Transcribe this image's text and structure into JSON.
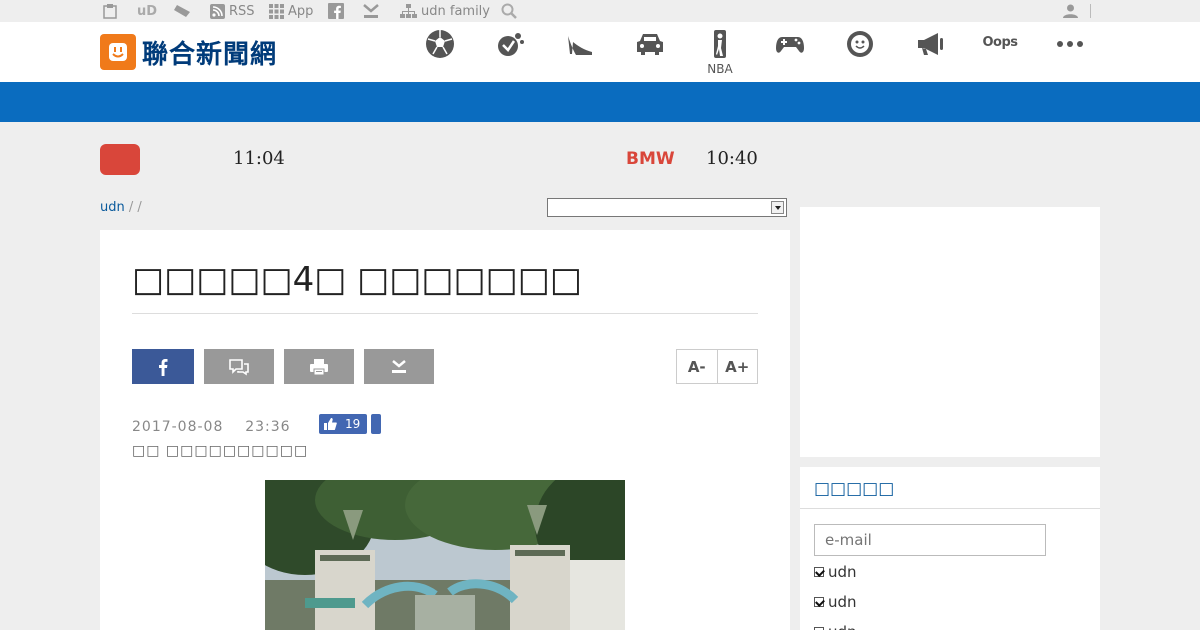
{
  "topbar": {
    "ud_label": "uD",
    "rss_label": "RSS",
    "app_label": "App",
    "family_label": "udn family"
  },
  "header": {
    "logo_text": "聯合新聞網",
    "nav": [
      {
        "icon": "soccer-ball-icon",
        "label": ""
      },
      {
        "icon": "paint-splash-icon",
        "label": ""
      },
      {
        "icon": "high-heel-icon",
        "label": ""
      },
      {
        "icon": "car-icon",
        "label": ""
      },
      {
        "icon": "nba-logo-icon",
        "label": "NBA"
      },
      {
        "icon": "gamepad-icon",
        "label": ""
      },
      {
        "icon": "smiley-face-icon",
        "label": ""
      },
      {
        "icon": "megaphone-icon",
        "label": ""
      },
      {
        "icon": "oops-icon",
        "label": "Oops"
      },
      {
        "icon": "more-dots-icon",
        "label": ""
      }
    ]
  },
  "ticker": {
    "time1": "11:04",
    "brand": "BMW",
    "time2": "10:40"
  },
  "breadcrumb": {
    "home": "udn",
    "sep1": " / ",
    "sep2": " /"
  },
  "article": {
    "title": "□□□□□4□ □□□□□□□",
    "font_smaller": "A-",
    "font_larger": "A+",
    "date": "2017-08-08",
    "time": "23:36",
    "likes": "19",
    "byline": "□□ □□□□□□□□□□"
  },
  "subscribe": {
    "title": "□□□□□",
    "email_placeholder": "e-mail",
    "options": [
      {
        "label": "udn",
        "checked": true
      },
      {
        "label": "udn",
        "checked": true
      },
      {
        "label": "udn",
        "checked": true
      }
    ]
  },
  "colors": {
    "brand_blue": "#0a6cbf",
    "facebook": "#3b5998",
    "accent_red": "#d9463a",
    "logo_orange": "#f07a1a"
  }
}
